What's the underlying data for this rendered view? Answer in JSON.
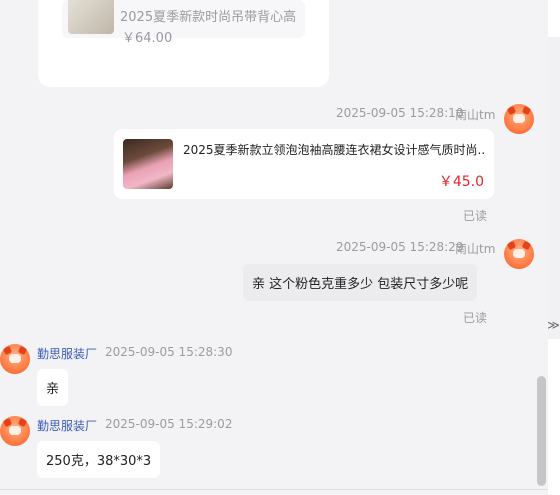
{
  "prev_card": {
    "title": "2025夏季新款时尚吊带背心高",
    "price": "￥64.00"
  },
  "messages": [
    {
      "kind": "product",
      "side": "right",
      "time": "2025-09-05 15:28:10",
      "sender": "南山tm",
      "product_title": "2025夏季新款立领泡泡袖高腰连衣裙女设计感气质时尚...",
      "product_price": "￥45.0",
      "status": "已读"
    },
    {
      "kind": "text",
      "side": "right",
      "time": "2025-09-05 15:28:29",
      "sender": "南山tm",
      "text": "亲 这个粉色克重多少  包装尺寸多少呢",
      "status": "已读"
    },
    {
      "kind": "text",
      "side": "left",
      "sender": "勤思服装厂",
      "time": "2025-09-05 15:28:30",
      "text": "亲"
    },
    {
      "kind": "text",
      "side": "left",
      "sender": "勤思服装厂",
      "time": "2025-09-05 15:29:02",
      "text": "250克，38*30*3"
    }
  ],
  "collapse_glyph": "≫",
  "colors": {
    "price_red": "#e3262b",
    "seller_name_blue": "#3a5ab8",
    "avatar_orange": "#ff7d45",
    "my_bubble": "#ececef"
  },
  "icons": {
    "avatar": "fox-cat-orange-avatar-icon",
    "collapse": "double-chevron-right-icon"
  }
}
